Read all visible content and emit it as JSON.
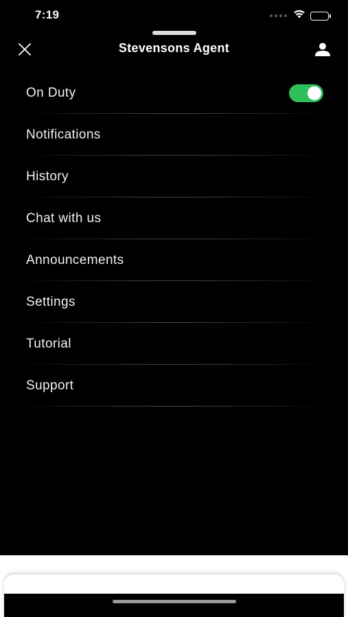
{
  "status_bar": {
    "time": "7:19",
    "icons": [
      "signal-icon",
      "wifi-icon",
      "battery-icon"
    ]
  },
  "nav": {
    "title": "Stevensons Agent",
    "left_icon": "close-icon",
    "right_icon": "profile-icon"
  },
  "menu": {
    "items": [
      {
        "label": "On Duty",
        "toggle": true
      },
      {
        "label": "Notifications"
      },
      {
        "label": "History"
      },
      {
        "label": "Chat with us"
      },
      {
        "label": "Announcements"
      },
      {
        "label": "Settings"
      },
      {
        "label": "Tutorial"
      },
      {
        "label": "Support"
      }
    ]
  },
  "colors": {
    "background": "#000000",
    "text": "#ffffff",
    "toggle_on": "#2fbe5c"
  }
}
